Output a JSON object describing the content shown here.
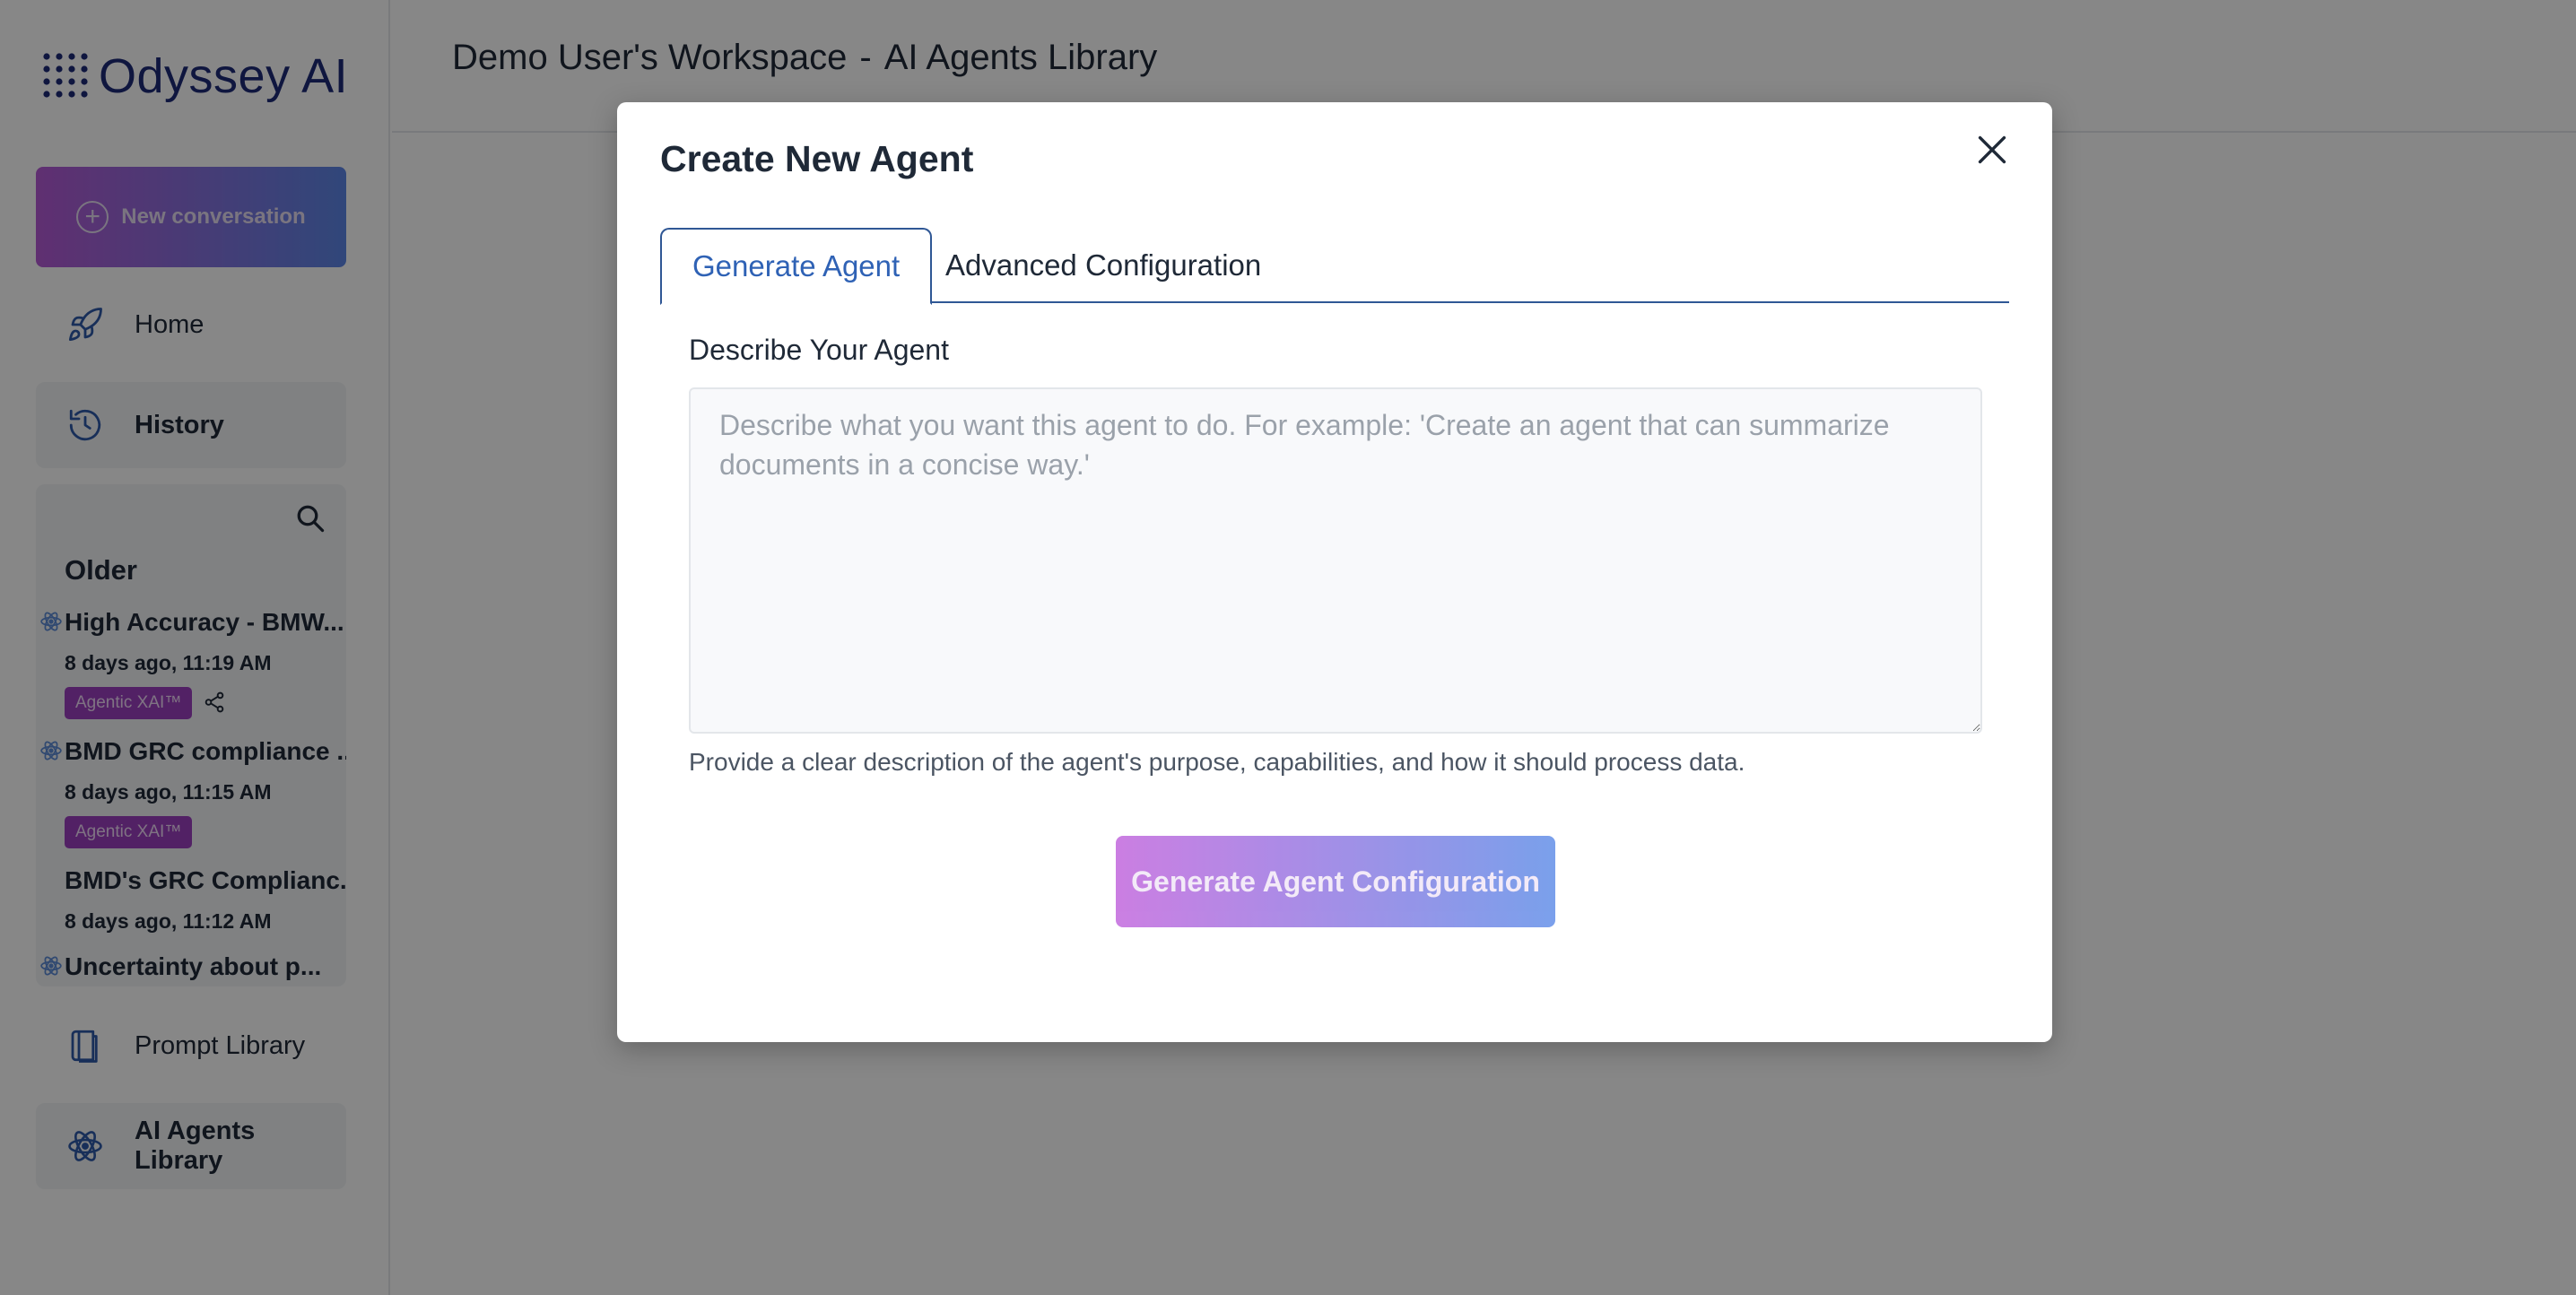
{
  "app": {
    "brand": "Odyssey AI"
  },
  "sidebar": {
    "new_conversation_label": "New conversation",
    "nav": {
      "home": "Home",
      "history": "History",
      "prompt_library": "Prompt Library",
      "ai_agents_library": "AI Agents Library"
    },
    "history": {
      "group_label": "Older",
      "items": [
        {
          "title": "High Accuracy - BMW...",
          "time": "8 days ago, 11:19 AM",
          "badge": "Agentic XAI™",
          "has_agent_icon": true,
          "shareable": true
        },
        {
          "title": "BMD GRC compliance ...",
          "time": "8 days ago, 11:15 AM",
          "badge": "Agentic XAI™",
          "has_agent_icon": true,
          "shareable": false
        },
        {
          "title": "BMD's GRC Complianc...",
          "time": "8 days ago, 11:12 AM",
          "badge": "",
          "has_agent_icon": false,
          "shareable": false
        },
        {
          "title": "Uncertainty about p...",
          "time": "",
          "badge": "",
          "has_agent_icon": true,
          "shareable": false
        }
      ]
    }
  },
  "header": {
    "workspace": "Demo User's Workspace",
    "separator": "-",
    "section": "AI Agents Library"
  },
  "modal": {
    "title": "Create New Agent",
    "tabs": [
      {
        "label": "Generate Agent",
        "active": true
      },
      {
        "label": "Advanced Configuration",
        "active": false
      }
    ],
    "field_label": "Describe Your Agent",
    "textarea": {
      "value": "",
      "placeholder": "Describe what you want this agent to do. For example: 'Create an agent that can summarize documents in a concise way.'"
    },
    "help_text": "Provide a clear description of the agent's purpose, capabilities, and how it should process data.",
    "primary_button": "Generate Agent Configuration"
  },
  "colors": {
    "brand_navy": "#1e2a78",
    "accent_blue": "#2f62b5",
    "badge_purple": "#9c3fbf",
    "gradient_start": "#c774e0",
    "gradient_end": "#6f98ea"
  }
}
